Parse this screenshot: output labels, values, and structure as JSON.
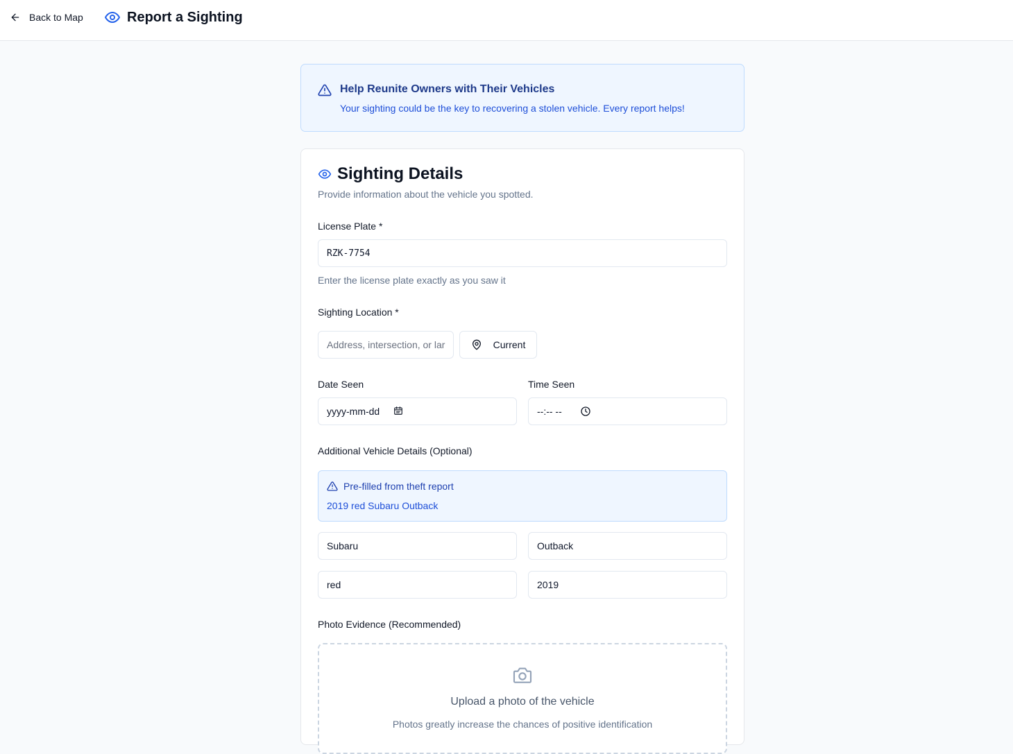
{
  "header": {
    "back_label": "Back to Map",
    "title": "Report a Sighting"
  },
  "alert": {
    "title": "Help Reunite Owners with Their Vehicles",
    "text": "Your sighting could be the key to recovering a stolen vehicle. Every report helps!"
  },
  "card": {
    "title": "Sighting Details",
    "subtitle": "Provide information about the vehicle you spotted."
  },
  "license_plate": {
    "label": "License Plate *",
    "value": "RZK-7754",
    "hint": "Enter the license plate exactly as you saw it"
  },
  "location": {
    "label": "Sighting Location *",
    "placeholder": "Address, intersection, or lar",
    "current_button": "Current"
  },
  "date": {
    "label": "Date Seen",
    "value": "yyyy-mm-dd"
  },
  "time": {
    "label": "Time Seen",
    "value": "--:-- --"
  },
  "vehicle_details": {
    "label": "Additional Vehicle Details (Optional)",
    "prefill_title": "Pre-filled from theft report",
    "prefill_text": "2019 red Subaru Outback",
    "make": "Subaru",
    "model": "Outback",
    "color": "red",
    "year": "2019"
  },
  "photo": {
    "label": "Photo Evidence (Recommended)",
    "upload_title": "Upload a photo of the vehicle",
    "upload_sub": "Photos greatly increase the chances of positive identification"
  },
  "colors": {
    "accent": "#2563eb",
    "info_bg": "#eff6ff",
    "info_border": "#bfdbfe",
    "info_title": "#1e3a8a",
    "info_text": "#1d4ed8"
  },
  "icons": [
    "arrow-left-icon",
    "eye-icon",
    "alert-triangle-icon",
    "map-pin-icon",
    "calendar-icon",
    "clock-icon",
    "camera-icon"
  ]
}
